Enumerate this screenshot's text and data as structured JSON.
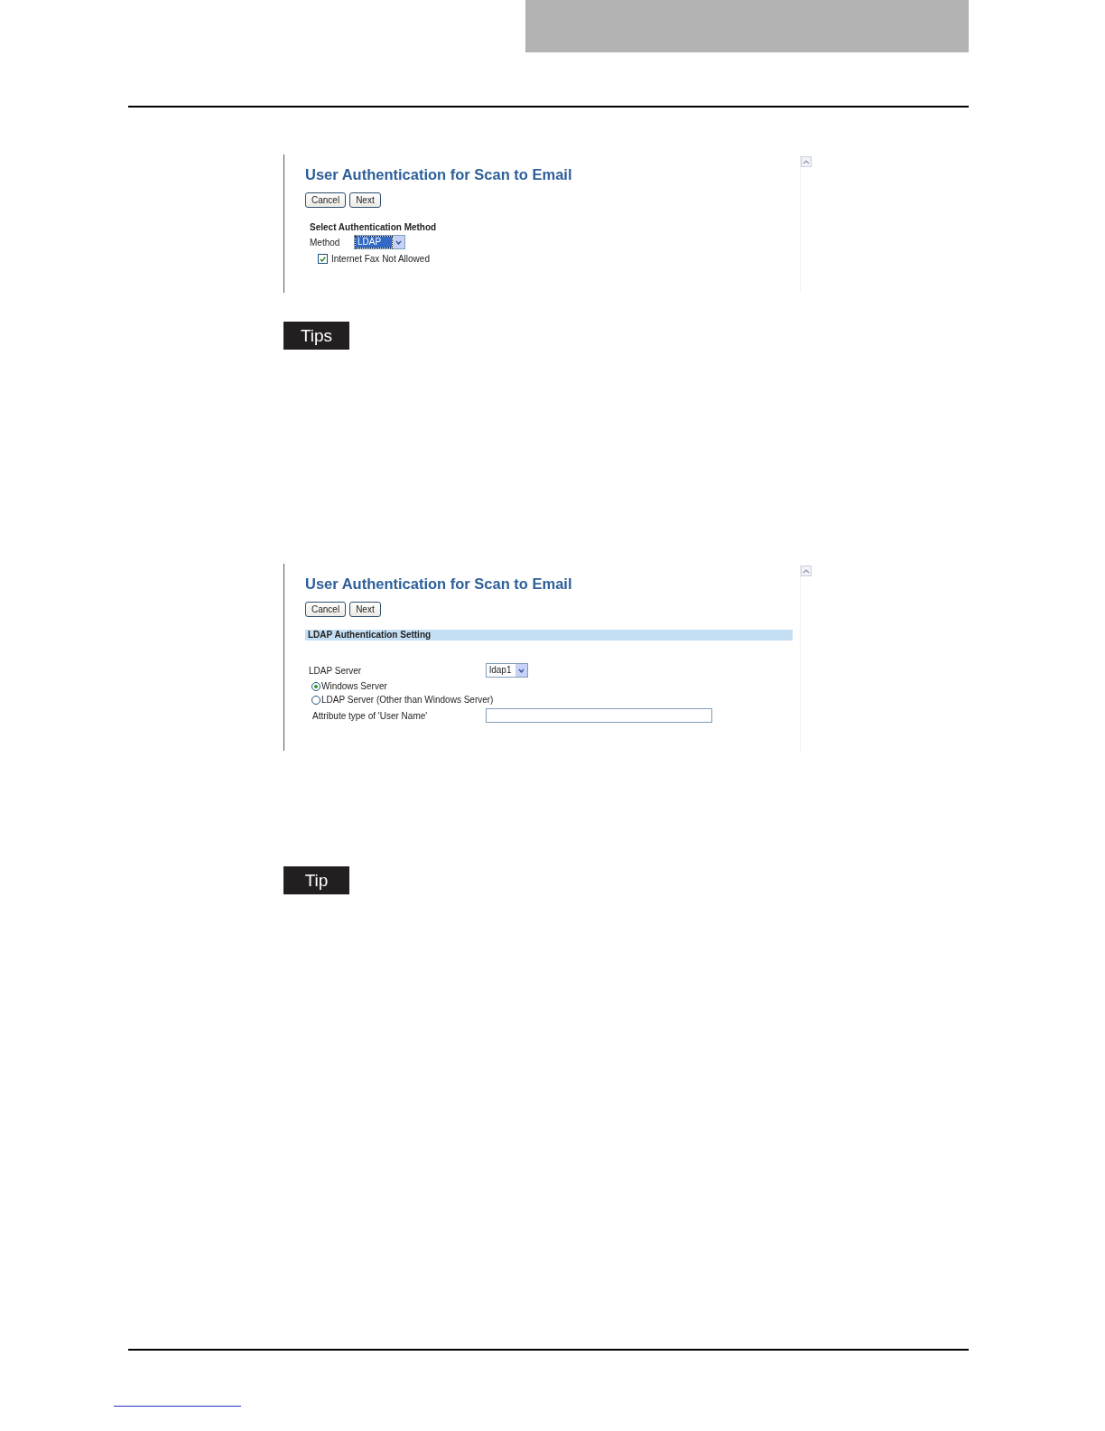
{
  "blocks": [
    {
      "kind": "method_screen",
      "title": "User Authentication for Scan to Email",
      "buttons": [
        "Cancel",
        "Next"
      ],
      "section": "Select Authentication Method",
      "method_label": "Method",
      "method_value": "LDAP",
      "checkbox": {
        "label": "Internet Fax Not Allowed",
        "checked": true
      }
    },
    {
      "kind": "note",
      "label": "Tips"
    },
    {
      "kind": "ldap_screen",
      "title": "User Authentication for Scan to Email",
      "buttons": [
        "Cancel",
        "Next"
      ],
      "section_bar": "LDAP Authentication Setting",
      "server_label": "LDAP Server",
      "server_value": "ldap1",
      "radios": [
        {
          "label": "Windows Server",
          "selected": true
        },
        {
          "label": "LDAP Server (Other than Windows Server)",
          "selected": false
        }
      ],
      "attribute_label": "Attribute type of 'User Name'"
    },
    {
      "kind": "note",
      "label": "Tip"
    }
  ]
}
